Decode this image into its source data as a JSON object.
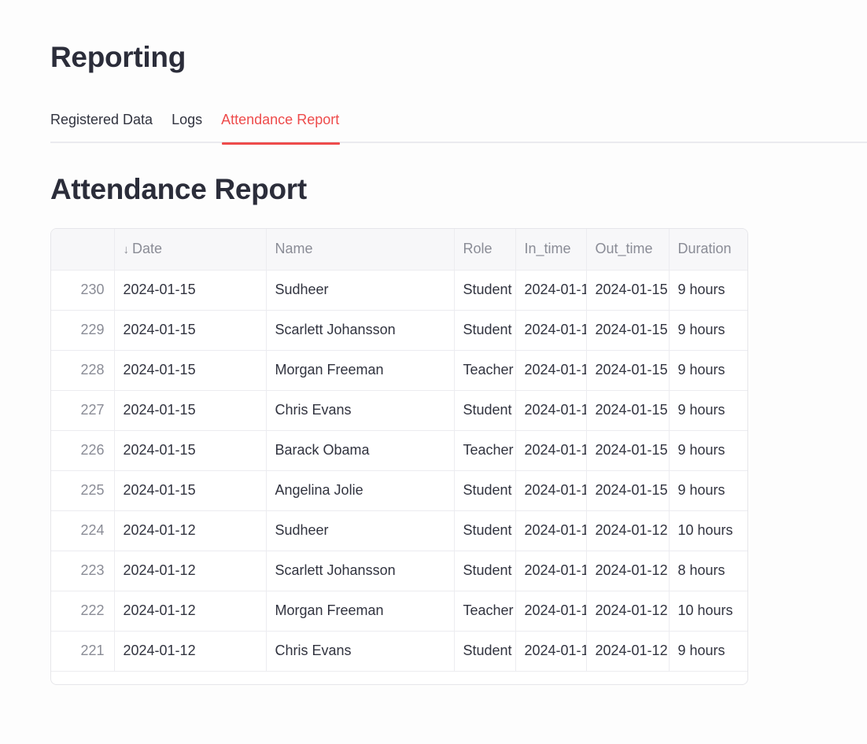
{
  "page": {
    "title": "Reporting"
  },
  "tabs": [
    {
      "label": "Registered Data",
      "active": false
    },
    {
      "label": "Logs",
      "active": false
    },
    {
      "label": "Attendance Report",
      "active": true
    }
  ],
  "section": {
    "title": "Attendance Report"
  },
  "table": {
    "columns": [
      {
        "label": ""
      },
      {
        "label": "Date",
        "sort_icon": "↓"
      },
      {
        "label": "Name"
      },
      {
        "label": "Role"
      },
      {
        "label": "In_time"
      },
      {
        "label": "Out_time"
      },
      {
        "label": "Duration"
      }
    ],
    "rows": [
      {
        "index": "230",
        "date": "2024-01-15",
        "name": "Sudheer",
        "role": "Student",
        "in_time": "2024-01-1",
        "out_time": "2024-01-15",
        "duration": "9 hours"
      },
      {
        "index": "229",
        "date": "2024-01-15",
        "name": "Scarlett Johansson",
        "role": "Student",
        "in_time": "2024-01-1",
        "out_time": "2024-01-15",
        "duration": "9 hours"
      },
      {
        "index": "228",
        "date": "2024-01-15",
        "name": "Morgan Freeman",
        "role": "Teacher",
        "in_time": "2024-01-1",
        "out_time": "2024-01-15",
        "duration": "9 hours"
      },
      {
        "index": "227",
        "date": "2024-01-15",
        "name": "Chris Evans",
        "role": "Student",
        "in_time": "2024-01-1",
        "out_time": "2024-01-15",
        "duration": "9 hours"
      },
      {
        "index": "226",
        "date": "2024-01-15",
        "name": "Barack Obama",
        "role": "Teacher",
        "in_time": "2024-01-1",
        "out_time": "2024-01-15",
        "duration": "9 hours"
      },
      {
        "index": "225",
        "date": "2024-01-15",
        "name": "Angelina Jolie",
        "role": "Student",
        "in_time": "2024-01-1",
        "out_time": "2024-01-15",
        "duration": "9 hours"
      },
      {
        "index": "224",
        "date": "2024-01-12",
        "name": "Sudheer",
        "role": "Student",
        "in_time": "2024-01-1",
        "out_time": "2024-01-12",
        "duration": "10 hours"
      },
      {
        "index": "223",
        "date": "2024-01-12",
        "name": "Scarlett Johansson",
        "role": "Student",
        "in_time": "2024-01-1",
        "out_time": "2024-01-12",
        "duration": "8 hours"
      },
      {
        "index": "222",
        "date": "2024-01-12",
        "name": "Morgan Freeman",
        "role": "Teacher",
        "in_time": "2024-01-1",
        "out_time": "2024-01-12",
        "duration": "10 hours"
      },
      {
        "index": "221",
        "date": "2024-01-12",
        "name": "Chris Evans",
        "role": "Student",
        "in_time": "2024-01-1",
        "out_time": "2024-01-12",
        "duration": "9 hours"
      }
    ]
  },
  "colors": {
    "accent": "#ee4b4b",
    "text": "#31333f",
    "muted": "#8a8c96",
    "header_bg": "#f7f7f9",
    "border": "#ececf0"
  }
}
